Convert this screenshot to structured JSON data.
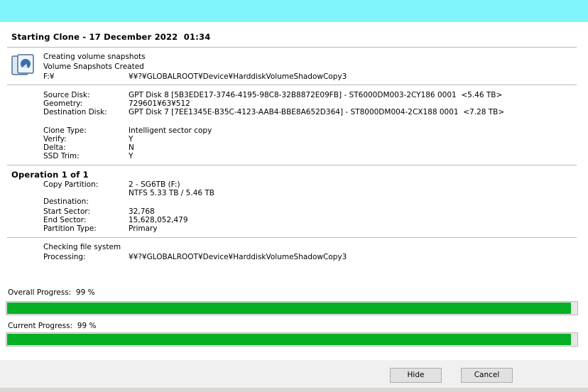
{
  "header": {
    "title": "Starting Clone - 17 December 2022  01:34"
  },
  "snapshot": {
    "line1": "Creating volume snapshots",
    "line2": "Volume Snapshots Created",
    "drive": "F:¥",
    "path": "¥¥?¥GLOBALROOT¥Device¥HarddiskVolumeShadowCopy3"
  },
  "disks": {
    "source_label": "Source Disk:",
    "source_value": "GPT Disk 8 [5B3EDE17-3746-4195-98C8-32B8872E09FB] - ST6000DM003-2CY186 0001  <5.46 TB>",
    "geometry_label": "Geometry:",
    "geometry_value": "729601¥63¥512",
    "destination_label": "Destination Disk:",
    "destination_value": "GPT Disk 7 [7EE1345E-B35C-4123-AAB4-BBE8A652D364] - ST8000DM004-2CX188 0001  <7.28 TB>"
  },
  "options": {
    "clone_type_label": "Clone Type:",
    "clone_type_value": "Intelligent sector copy",
    "verify_label": "Verify:",
    "verify_value": "Y",
    "delta_label": "Delta:",
    "delta_value": "N",
    "ssd_trim_label": "SSD Trim:",
    "ssd_trim_value": "Y"
  },
  "operation": {
    "title": "Operation 1 of 1",
    "copy_partition_label": "Copy Partition:",
    "copy_partition_value": "2 - SG6TB (F:)",
    "copy_partition_detail": "NTFS 5.33 TB / 5.46 TB",
    "destination_label": "Destination:",
    "start_sector_label": "Start Sector:",
    "start_sector_value": "32,768",
    "end_sector_label": "End Sector:",
    "end_sector_value": "15,628,052,479",
    "partition_type_label": "Partition Type:",
    "partition_type_value": "Primary"
  },
  "status": {
    "checking": "Checking file system",
    "processing_label": "Processing:",
    "processing_value": "¥¥?¥GLOBALROOT¥Device¥HarddiskVolumeShadowCopy3"
  },
  "progress": {
    "overall_label": "Overall Progress:  99 %",
    "overall_fraction": 0.99,
    "current_label": "Current Progress:  99 %",
    "current_fraction": 0.99
  },
  "buttons": {
    "hide": "Hide",
    "cancel": "Cancel"
  },
  "colors": {
    "titlebar": "#7ff5fb",
    "progress_fill": "#06b025"
  }
}
